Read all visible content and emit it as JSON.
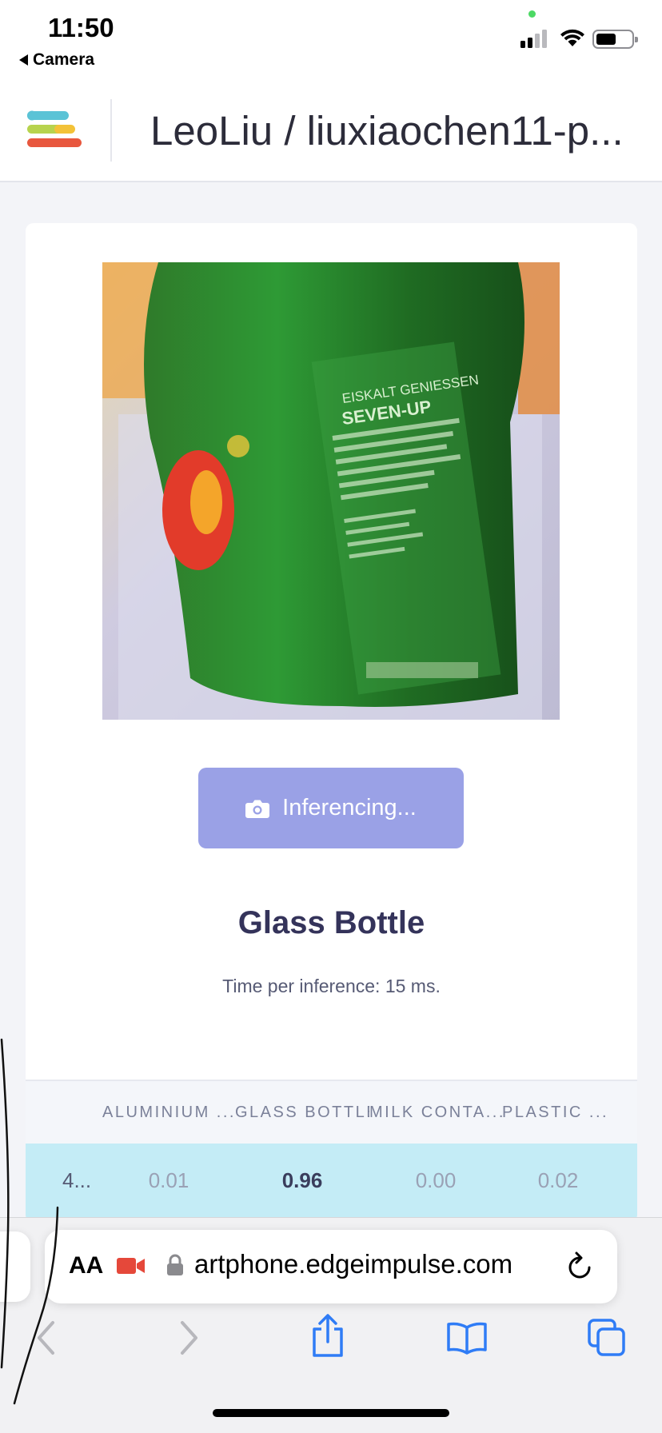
{
  "status_bar": {
    "time": "11:50",
    "back_app": "Camera"
  },
  "header": {
    "project_title": "LeoLiu / liuxiaochen11-p..."
  },
  "inference": {
    "button_label": "Inferencing...",
    "result_label": "Glass Bottle",
    "timing_text": "Time per inference: 15 ms."
  },
  "results_table": {
    "columns": [
      "",
      "ALUMINIUM ...",
      "GLASS BOTTLE",
      "MILK CONTA...",
      "PLASTIC ..."
    ],
    "rows": [
      [
        "4...",
        "0.01",
        "0.96",
        "0.00",
        "0.02"
      ]
    ]
  },
  "browser": {
    "aa_label": "AA",
    "url": "artphone.edgeimpulse.com"
  },
  "icons": {
    "menu": "logo-icon",
    "camera": "camera-icon",
    "lock": "lock-icon",
    "video": "video-icon",
    "reload": "reload-icon",
    "back": "chevron-left-icon",
    "forward": "chevron-right-icon",
    "share": "share-icon",
    "bookmarks": "book-icon",
    "tabs": "tabs-icon"
  },
  "colors": {
    "button": "#9aa1e6",
    "row_highlight": "#c4ecf6",
    "safari_blue": "#2f7cf6"
  }
}
